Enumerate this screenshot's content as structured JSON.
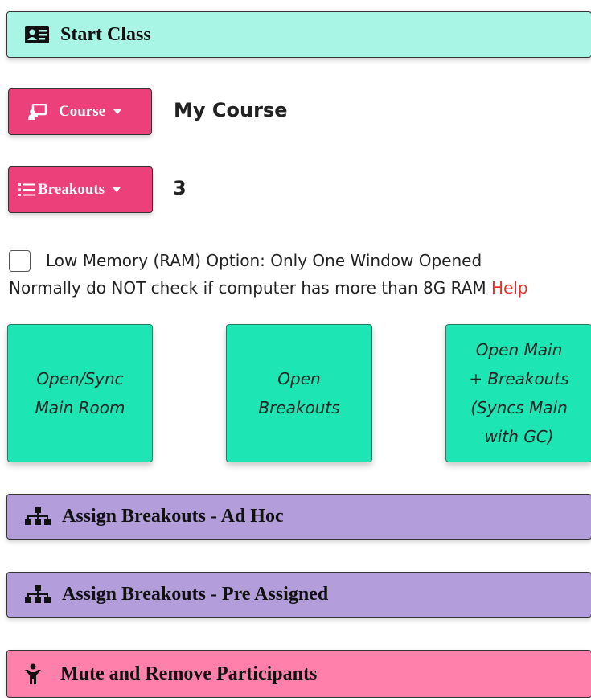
{
  "start_class": {
    "label": "Start Class",
    "icon": "id-card-icon"
  },
  "course": {
    "button_label": "Course",
    "icon": "chalkboard-icon",
    "selected": "My Course"
  },
  "breakouts": {
    "button_label": "Breakouts",
    "icon": "list-icon",
    "count": "3"
  },
  "low_memory": {
    "label": "Low Memory (RAM) Option: Only One Window Opened",
    "checked": false,
    "note": "Normally do NOT check if computer has more than 8G RAM",
    "help_link": "Help"
  },
  "rooms": {
    "main": [
      "Open/Sync",
      "Main Room"
    ],
    "breakouts": [
      "Open",
      "Breakouts"
    ],
    "both": [
      "Open Main",
      "+ Breakouts",
      "(Syncs Main",
      "with GC)"
    ]
  },
  "sections": {
    "adhoc": "Assign Breakouts - Ad Hoc",
    "pre_assigned": "Assign Breakouts - Pre Assigned",
    "mute": "Mute and Remove Participants"
  },
  "colors": {
    "start_bg": "#a8f5e6",
    "pink_btn": "#ec407a",
    "room_btn": "#1de6b4",
    "purple_bar": "#b39ddb",
    "mute_bar": "#ff80ab",
    "help": "#e8302a"
  }
}
